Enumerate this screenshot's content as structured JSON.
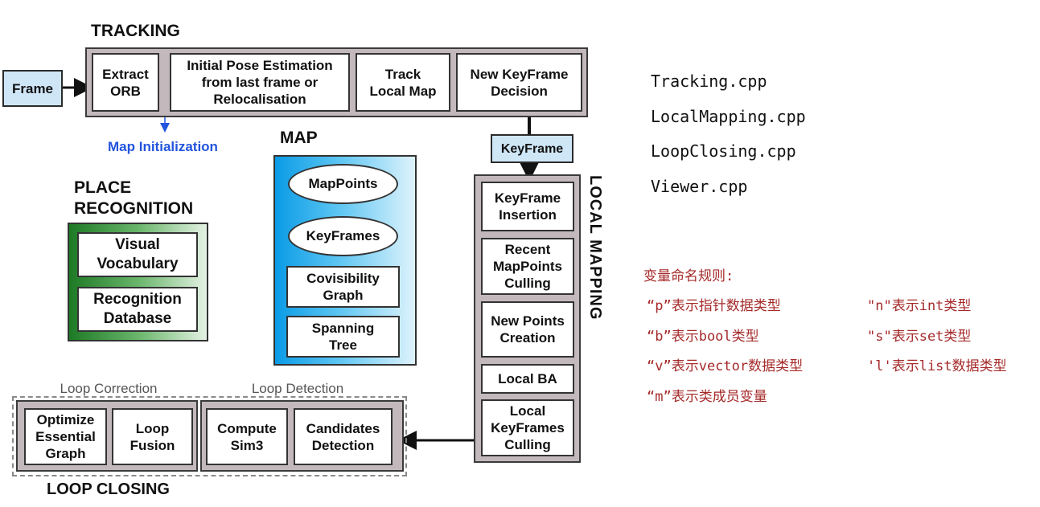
{
  "tracking": {
    "title": "TRACKING",
    "frame": "Frame",
    "extract_orb": "Extract\nORB",
    "initial_pose": "Initial Pose Estimation\nfrom last frame or\nRelocalisation",
    "track_local_map": "Track\nLocal Map",
    "new_keyframe_decision": "New KeyFrame\nDecision",
    "map_initialization": "Map Initialization"
  },
  "keyframe": "KeyFrame",
  "map": {
    "title": "MAP",
    "mappoints": "MapPoints",
    "keyframes": "KeyFrames",
    "covisibility": "Covisibility\nGraph",
    "spanning": "Spanning\nTree"
  },
  "place_recognition": {
    "title": "PLACE\nRECOGNITION",
    "visual_vocabulary": "Visual\nVocabulary",
    "recognition_database": "Recognition\nDatabase"
  },
  "local_mapping": {
    "title": "LOCAL MAPPING",
    "keyframe_insertion": "KeyFrame\nInsertion",
    "recent_culling": "Recent\nMapPoints\nCulling",
    "new_points": "New Points\nCreation",
    "local_ba": "Local BA",
    "local_kf_culling": "Local\nKeyFrames\nCulling"
  },
  "loop_closing": {
    "title": "LOOP CLOSING",
    "loop_correction": "Loop Correction",
    "loop_detection": "Loop Detection",
    "optimize": "Optimize\nEssential\nGraph",
    "loop_fusion": "Loop\nFusion",
    "compute_sim3": "Compute\nSim3",
    "candidates": "Candidates\nDetection"
  },
  "files": [
    "Tracking.cpp",
    "LocalMapping.cpp",
    "LoopClosing.cpp",
    "Viewer.cpp"
  ],
  "naming": {
    "heading": "变量命名规则:",
    "rows": [
      {
        "left": "“p”表示指针数据类型",
        "right": "\"n\"表示int类型"
      },
      {
        "left": "“b”表示bool类型",
        "right": "\"s\"表示set类型"
      },
      {
        "left": "“v”表示vector数据类型",
        "right": "'l'表示list数据类型"
      },
      {
        "left": "“m”表示类成员变量",
        "right": ""
      }
    ]
  },
  "colors": {
    "panel_gray": "#c3b9bd",
    "keyframe_blue": "#cfe6f7",
    "map_blue": "#0a9be6",
    "place_green": "#1d7a25",
    "map_init_blue": "#2255dd",
    "rules_red": "#a52a2a"
  }
}
